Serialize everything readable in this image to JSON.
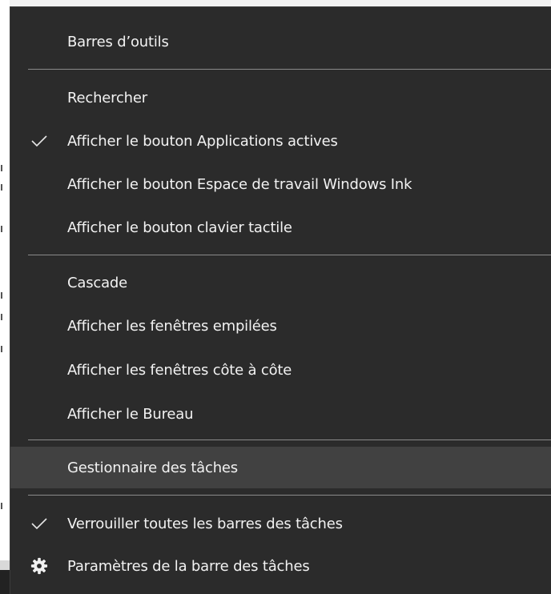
{
  "menu": {
    "items": [
      {
        "label": "Barres d’outils",
        "checked": false,
        "icon": null
      },
      {
        "label": "Rechercher",
        "checked": false,
        "icon": null
      },
      {
        "label": "Afficher le bouton Applications actives",
        "checked": true,
        "icon": "checkmark-icon"
      },
      {
        "label": "Afficher le bouton Espace de travail Windows Ink",
        "checked": false,
        "icon": null
      },
      {
        "label": "Afficher le bouton clavier tactile",
        "checked": false,
        "icon": null
      },
      {
        "label": "Cascade",
        "checked": false,
        "icon": null
      },
      {
        "label": "Afficher les fenêtres empilées",
        "checked": false,
        "icon": null
      },
      {
        "label": "Afficher les fenêtres côte à côte",
        "checked": false,
        "icon": null
      },
      {
        "label": "Afficher le Bureau",
        "checked": false,
        "icon": null
      },
      {
        "label": "Gestionnaire des tâches",
        "checked": false,
        "icon": null,
        "highlighted": true
      },
      {
        "label": "Verrouiller toutes les barres des tâches",
        "checked": true,
        "icon": "checkmark-icon"
      },
      {
        "label": "Paramètres de la barre des tâches",
        "checked": false,
        "icon": "gear-icon"
      }
    ]
  },
  "colors": {
    "menu_background": "#2b2b2b",
    "highlight_background": "#414141",
    "text": "#f2f2f2",
    "separator": "#8a8a8a"
  }
}
